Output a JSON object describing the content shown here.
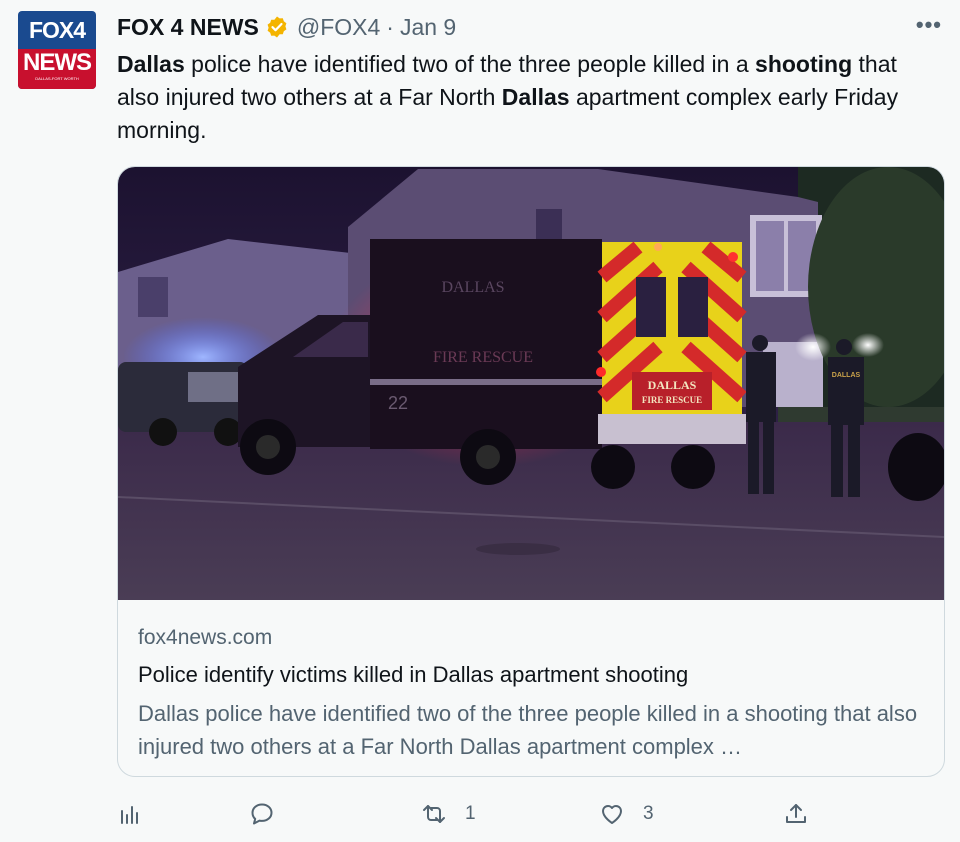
{
  "account": {
    "name": "FOX 4 NEWS",
    "handle": "@FOX4",
    "separator": "·",
    "date": "Jan 9",
    "avatar_top": "FOX4",
    "avatar_bottom": "NEWS",
    "avatar_sub": "DALLAS-FORT WORTH",
    "verified_color": "#f4b400"
  },
  "menu": {
    "more_label": "•••"
  },
  "tweet": {
    "segments": [
      {
        "text": "Dallas",
        "bold": true
      },
      {
        "text": " police have identified two of the three people killed in a ",
        "bold": false
      },
      {
        "text": "shooting",
        "bold": true
      },
      {
        "text": " that also injured two others at a Far North ",
        "bold": false
      },
      {
        "text": "Dallas",
        "bold": true
      },
      {
        "text": " apartment complex early Friday morning.",
        "bold": false
      }
    ]
  },
  "card": {
    "domain": "fox4news.com",
    "title": "Police identify victims killed in Dallas apartment shooting",
    "description": "Dallas police have identified two of the three people killed in a shooting that also injured two others at a Far North Dallas apartment complex …",
    "image": {
      "truck_text": "DALLAS",
      "truck_side_text": "FIRE RESCUE",
      "truck_rear_text_1": "DALLAS",
      "truck_rear_text_2": "FIRE RESCUE",
      "unit_number": "22",
      "officer_text": "DALLAS"
    }
  },
  "actions": {
    "analytics_icon": "analytics-icon",
    "reply_icon": "reply-icon",
    "retweet_icon": "retweet-icon",
    "retweet_count": "1",
    "like_icon": "heart-icon",
    "like_count": "3",
    "share_icon": "share-icon"
  },
  "colors": {
    "background": "#f7f9f9",
    "text": "#0f1419",
    "secondary": "#536471",
    "border": "#cfd9de",
    "fox_blue": "#1a4a8f",
    "fox_red": "#c8102e"
  }
}
